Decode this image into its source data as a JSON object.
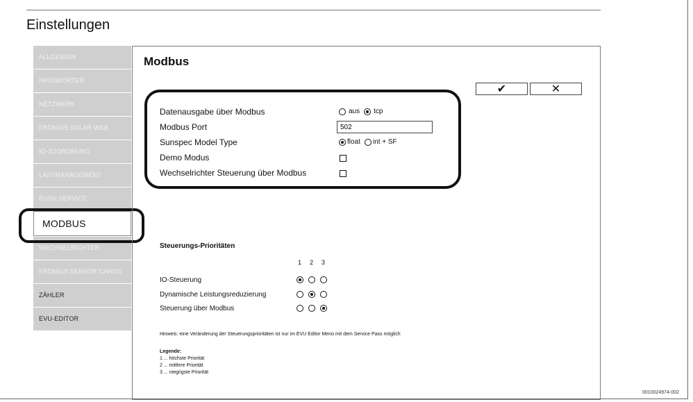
{
  "page": {
    "title": "Einstellungen",
    "figure_id": "0010024974-002"
  },
  "sidebar": {
    "items": [
      {
        "label": "ALLGEMEIN"
      },
      {
        "label": "PASSWÖRTER"
      },
      {
        "label": "NETZWERK"
      },
      {
        "label": "FRONIUS SOLAR.WEB"
      },
      {
        "label": "IO-ZUORDNUNG"
      },
      {
        "label": "LASTMANAGEMENT"
      },
      {
        "label": "PUSH SERVICE"
      },
      {
        "label": "MODBUS",
        "active": true
      },
      {
        "label": "WECHSELRICHTER"
      },
      {
        "label": "FRONIUS SENSOR CARDS"
      },
      {
        "label": "ZÄHLER"
      },
      {
        "label": "EVU-EDITOR"
      }
    ]
  },
  "main": {
    "section_title": "Modbus",
    "buttons": {
      "ok_icon": "✔",
      "cancel_icon": "✕"
    },
    "settings": {
      "data_output_label": "Datenausgabe über Modbus",
      "data_output_options": [
        "aus",
        "tcp"
      ],
      "data_output_selected": "tcp",
      "port_label": "Modbus Port",
      "port_value": "502",
      "sunspec_label": "Sunspec Model Type",
      "sunspec_options": [
        "float",
        "int + SF"
      ],
      "sunspec_selected": "float",
      "demo_label": "Demo Modus",
      "inverter_control_label": "Wechselrichter Steuerung über Modbus"
    },
    "priorities": {
      "title": "Steuerungs-Prioritäten",
      "columns": [
        "1",
        "2",
        "3"
      ],
      "rows": [
        {
          "label": "IO-Steuerung",
          "selected": 1
        },
        {
          "label": "Dynamische Leistungsreduzierung",
          "selected": 2
        },
        {
          "label": "Steuerung über Modbus",
          "selected": 3
        }
      ]
    },
    "hint": "Hinweis: eine Veränderung der Steuerungsprioritäten ist nur im EVU Editor Menü mit dem Service Pass möglich",
    "legend": {
      "title": "Legende:",
      "items": [
        "1 ... höchste Priorität",
        "2 ... mittlere Priorität",
        "3 ... niegrigste Priorität"
      ]
    }
  }
}
